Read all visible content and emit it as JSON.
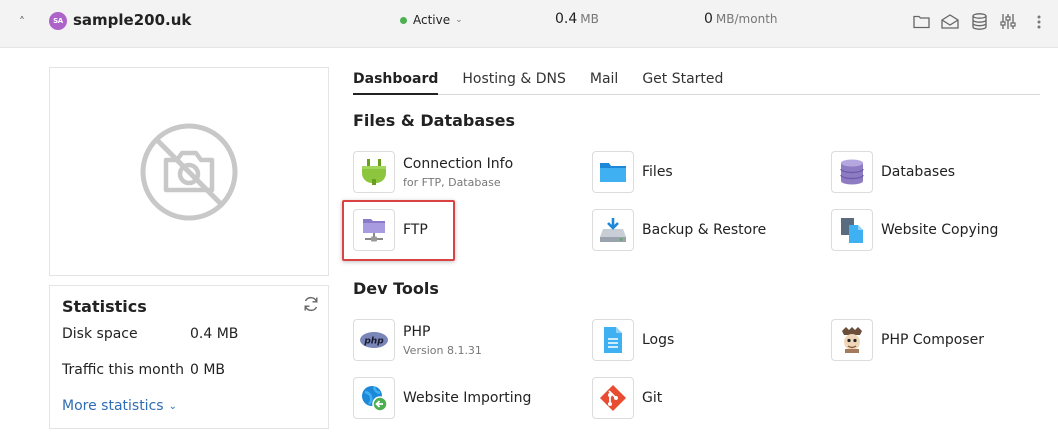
{
  "header": {
    "collapse_glyph": "˄",
    "avatar_initials": "SA",
    "domain": "sample200.uk",
    "status": "Active",
    "status_caret": "⌄",
    "disk_value": "0.4",
    "disk_unit": "MB",
    "traffic_value": "0",
    "traffic_unit": "MB/month",
    "icons": [
      "folder-icon",
      "mail-icon",
      "database-icon",
      "sliders-icon",
      "kebab-menu-icon"
    ]
  },
  "colors": {
    "avatar": "#ac64c8",
    "status_active": "#4caf50",
    "link": "#2f6db5",
    "highlight": "#d94343"
  },
  "preview": {
    "icon": "no-camera-icon"
  },
  "statistics": {
    "title": "Statistics",
    "rows": [
      {
        "label": "Disk space",
        "value": "0.4 MB"
      },
      {
        "label": "Traffic this month",
        "value": "0 MB"
      }
    ],
    "more_link": "More statistics",
    "more_caret": "⌄"
  },
  "tabs": [
    {
      "label": "Dashboard",
      "active": true
    },
    {
      "label": "Hosting & DNS",
      "active": false
    },
    {
      "label": "Mail",
      "active": false
    },
    {
      "label": "Get Started",
      "active": false
    }
  ],
  "files_databases": {
    "title": "Files & Databases",
    "items": [
      {
        "label": "Connection Info",
        "sub": "for FTP, Database",
        "icon": "plug-icon"
      },
      {
        "label": "Files",
        "icon": "folder-icon"
      },
      {
        "label": "Databases",
        "icon": "database-icon"
      },
      {
        "label": "FTP",
        "icon": "ftp-folder-icon"
      },
      {
        "label": "Backup & Restore",
        "icon": "backup-icon"
      },
      {
        "label": "Website Copying",
        "icon": "copy-icon"
      }
    ]
  },
  "dev_tools": {
    "title": "Dev Tools",
    "items": [
      {
        "label": "PHP",
        "sub": "Version 8.1.31",
        "icon": "php-icon",
        "badge": "php"
      },
      {
        "label": "Logs",
        "icon": "logs-icon"
      },
      {
        "label": "PHP Composer",
        "icon": "composer-icon"
      },
      {
        "label": "Website Importing",
        "icon": "import-icon"
      },
      {
        "label": "Git",
        "icon": "git-icon"
      }
    ]
  }
}
